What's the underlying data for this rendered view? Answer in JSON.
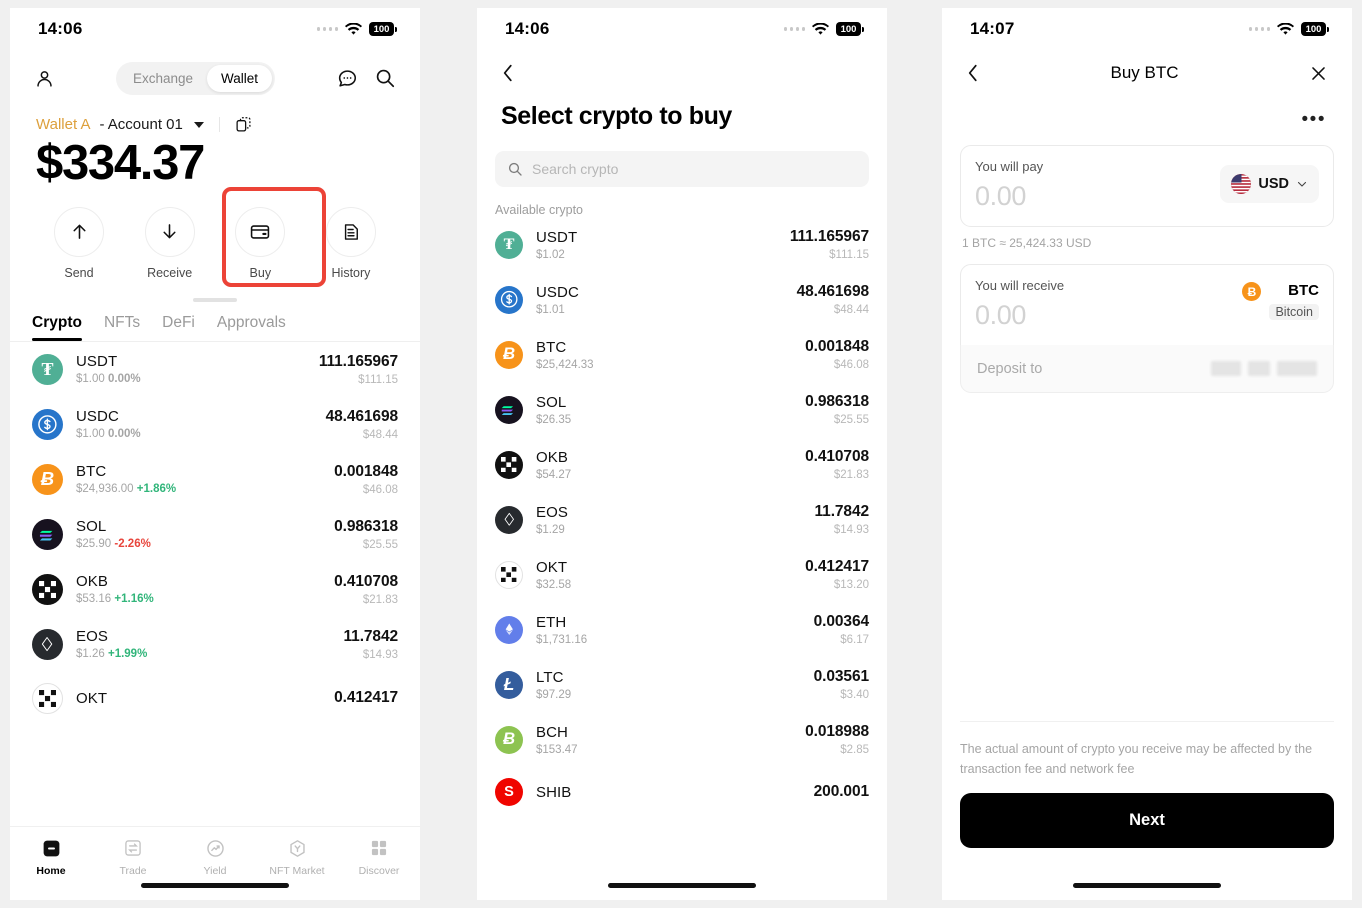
{
  "panel1": {
    "statusbar": {
      "time": "14:06",
      "battery": "100",
      "wifi_icon": "wifi-icon",
      "signal_icon": "signal-dots-icon"
    },
    "header": {
      "profile_icon": "person-icon",
      "segment": {
        "left": "Exchange",
        "right": "Wallet",
        "active": "Wallet"
      },
      "chat_icon": "chat-bubble-icon",
      "search_icon": "search-icon"
    },
    "wallet": {
      "name": "Wallet A",
      "account": "- Account 01",
      "dropdown_icon": "chevron-down-icon",
      "copy_icon": "copy-icon",
      "balance": "$334.37"
    },
    "actions": [
      {
        "label": "Send",
        "icon": "arrow-up-icon"
      },
      {
        "label": "Receive",
        "icon": "arrow-down-icon"
      },
      {
        "label": "Buy",
        "icon": "credit-card-icon",
        "highlighted": true
      },
      {
        "label": "History",
        "icon": "document-icon"
      }
    ],
    "highlight_color": "#ec4337",
    "tabs": [
      {
        "label": "Crypto",
        "active": true
      },
      {
        "label": "NFTs",
        "active": false
      },
      {
        "label": "DeFi",
        "active": false
      },
      {
        "label": "Approvals",
        "active": false
      }
    ],
    "coins": [
      {
        "symbol": "USDT",
        "price": "$1.00",
        "change": "0.00%",
        "dir": "flat",
        "amount": "111.165967",
        "fiat": "$111.15",
        "color": "#50af95",
        "glyph": "T"
      },
      {
        "symbol": "USDC",
        "price": "$1.00",
        "change": "0.00%",
        "dir": "flat",
        "amount": "48.461698",
        "fiat": "$48.44",
        "color": "#2775ca",
        "glyph": "$"
      },
      {
        "symbol": "BTC",
        "price": "$24,936.00",
        "change": "+1.86%",
        "dir": "up",
        "amount": "0.001848",
        "fiat": "$46.08",
        "color": "#f7931a",
        "glyph": "Ƀ"
      },
      {
        "symbol": "SOL",
        "price": "$25.90",
        "change": "-2.26%",
        "dir": "down",
        "amount": "0.986318",
        "fiat": "$25.55",
        "color": "#17121f",
        "glyph": "S"
      },
      {
        "symbol": "OKB",
        "price": "$53.16",
        "change": "+1.16%",
        "dir": "up",
        "amount": "0.410708",
        "fiat": "$21.83",
        "color": "#111111",
        "glyph": "O"
      },
      {
        "symbol": "EOS",
        "price": "$1.26",
        "change": "+1.99%",
        "dir": "up",
        "amount": "11.7842",
        "fiat": "$14.93",
        "color": "#272a2e",
        "glyph": "E"
      },
      {
        "symbol": "OKT",
        "price": "",
        "change": "",
        "dir": "flat",
        "amount": "0.412417",
        "fiat": "",
        "color": "#ffffff",
        "glyph": "K"
      }
    ],
    "bottomnav": [
      {
        "label": "Home",
        "icon": "home-icon",
        "active": true
      },
      {
        "label": "Trade",
        "icon": "trade-arrows-icon",
        "active": false
      },
      {
        "label": "Yield",
        "icon": "yield-chart-icon",
        "active": false
      },
      {
        "label": "NFT Market",
        "icon": "nft-hexagon-icon",
        "active": false
      },
      {
        "label": "Discover",
        "icon": "grid-icon",
        "active": false
      }
    ]
  },
  "panel2": {
    "statusbar": {
      "time": "14:06",
      "battery": "100"
    },
    "back_icon": "chevron-left-icon",
    "title": "Select crypto to buy",
    "search": {
      "placeholder": "Search crypto",
      "icon": "search-icon",
      "value": ""
    },
    "section_label": "Available crypto",
    "coins": [
      {
        "symbol": "USDT",
        "price": "$1.02",
        "amount": "111.165967",
        "fiat": "$111.15",
        "color": "#50af95",
        "glyph": "T"
      },
      {
        "symbol": "USDC",
        "price": "$1.01",
        "amount": "48.461698",
        "fiat": "$48.44",
        "color": "#2775ca",
        "glyph": "$"
      },
      {
        "symbol": "BTC",
        "price": "$25,424.33",
        "amount": "0.001848",
        "fiat": "$46.08",
        "color": "#f7931a",
        "glyph": "Ƀ"
      },
      {
        "symbol": "SOL",
        "price": "$26.35",
        "amount": "0.986318",
        "fiat": "$25.55",
        "color": "#17121f",
        "glyph": "S"
      },
      {
        "symbol": "OKB",
        "price": "$54.27",
        "amount": "0.410708",
        "fiat": "$21.83",
        "color": "#111111",
        "glyph": "O"
      },
      {
        "symbol": "EOS",
        "price": "$1.29",
        "amount": "11.7842",
        "fiat": "$14.93",
        "color": "#272a2e",
        "glyph": "E"
      },
      {
        "symbol": "OKT",
        "price": "$32.58",
        "amount": "0.412417",
        "fiat": "$13.20",
        "color": "#ffffff",
        "glyph": "K"
      },
      {
        "symbol": "ETH",
        "price": "$1,731.16",
        "amount": "0.00364",
        "fiat": "$6.17",
        "color": "#627eea",
        "glyph": "Ξ"
      },
      {
        "symbol": "LTC",
        "price": "$97.29",
        "amount": "0.03561",
        "fiat": "$3.40",
        "color": "#345d9d",
        "glyph": "Ł"
      },
      {
        "symbol": "BCH",
        "price": "$153.47",
        "amount": "0.018988",
        "fiat": "$2.85",
        "color": "#8dc351",
        "glyph": "Ƀ"
      },
      {
        "symbol": "SHIB",
        "price": "",
        "amount": "200.001",
        "fiat": "",
        "color": "#f00500",
        "glyph": "S"
      }
    ]
  },
  "panel3": {
    "statusbar": {
      "time": "14:07",
      "battery": "100"
    },
    "back_icon": "chevron-left-icon",
    "title": "Buy BTC",
    "close_icon": "close-icon",
    "more_icon": "more-horizontal-icon",
    "pay": {
      "label": "You will pay",
      "value": "",
      "placeholder": "0.00",
      "currency": "USD",
      "currency_flag": "us-flag-icon",
      "chevron": "chevron-down-icon"
    },
    "rate": "1 BTC ≈ 25,424.33 USD",
    "receive": {
      "label": "You will receive",
      "value": "",
      "placeholder": "0.00",
      "symbol": "BTC",
      "name": "Bitcoin",
      "color": "#f7931a"
    },
    "deposit": {
      "label": "Deposit to",
      "value_redacted": true
    },
    "note": "The actual amount of crypto you receive may be affected by the transaction fee and network fee",
    "next_label": "Next"
  }
}
